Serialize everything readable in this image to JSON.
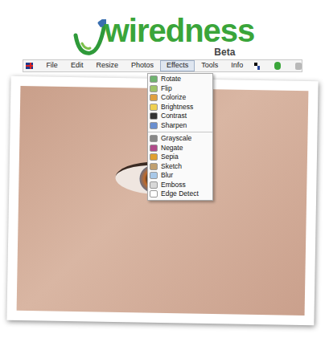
{
  "logo": {
    "name": "wiredness",
    "badge": "Beta"
  },
  "menu_bar": {
    "items": [
      {
        "label": "File",
        "selected": false
      },
      {
        "label": "Edit",
        "selected": false
      },
      {
        "label": "Resize",
        "selected": false
      },
      {
        "label": "Photos",
        "selected": false
      },
      {
        "label": "Effects",
        "selected": true
      },
      {
        "label": "Tools",
        "selected": false
      },
      {
        "label": "Info",
        "selected": false
      }
    ]
  },
  "effects_menu": {
    "groups": [
      [
        "Rotate",
        "Flip",
        "Colorize",
        "Brightness",
        "Contrast",
        "Sharpen"
      ],
      [
        "Grayscale",
        "Negate",
        "Sepia",
        "Sketch",
        "Blur",
        "Emboss",
        "Edge Detect"
      ]
    ]
  }
}
